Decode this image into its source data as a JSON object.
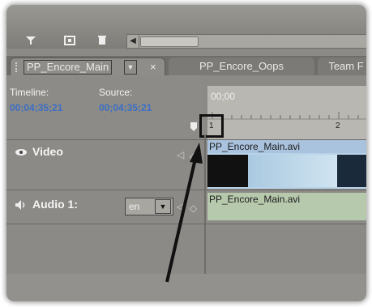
{
  "toolbar": {
    "icons": [
      "filter-icon",
      "grid-icon",
      "trash-icon"
    ],
    "scroll_left_glyph": "◀"
  },
  "tabs": [
    {
      "label": "PP_Encore_Main",
      "dropdown": "▼",
      "close": "×"
    },
    {
      "label": "PP_Encore_Oops"
    },
    {
      "label": "Team F"
    }
  ],
  "info": {
    "timeline_label": "Timeline:",
    "timeline_value": "00;04;35;21",
    "source_label": "Source:",
    "source_value": "00;04;35;21"
  },
  "ruler": {
    "start_time": "00;00",
    "marker_1": "1",
    "marker_2": "2"
  },
  "tracks": {
    "video": {
      "name": "Video",
      "clip_name": "PP_Encore_Main.avi"
    },
    "audio": {
      "name": "Audio 1:",
      "language": "en",
      "clip_name": "PP_Encore_Main.avi"
    }
  },
  "colors": {
    "timecode": "#3d6fc4",
    "video_clip": "#a9c3de",
    "audio_clip": "#b6c9ad"
  }
}
